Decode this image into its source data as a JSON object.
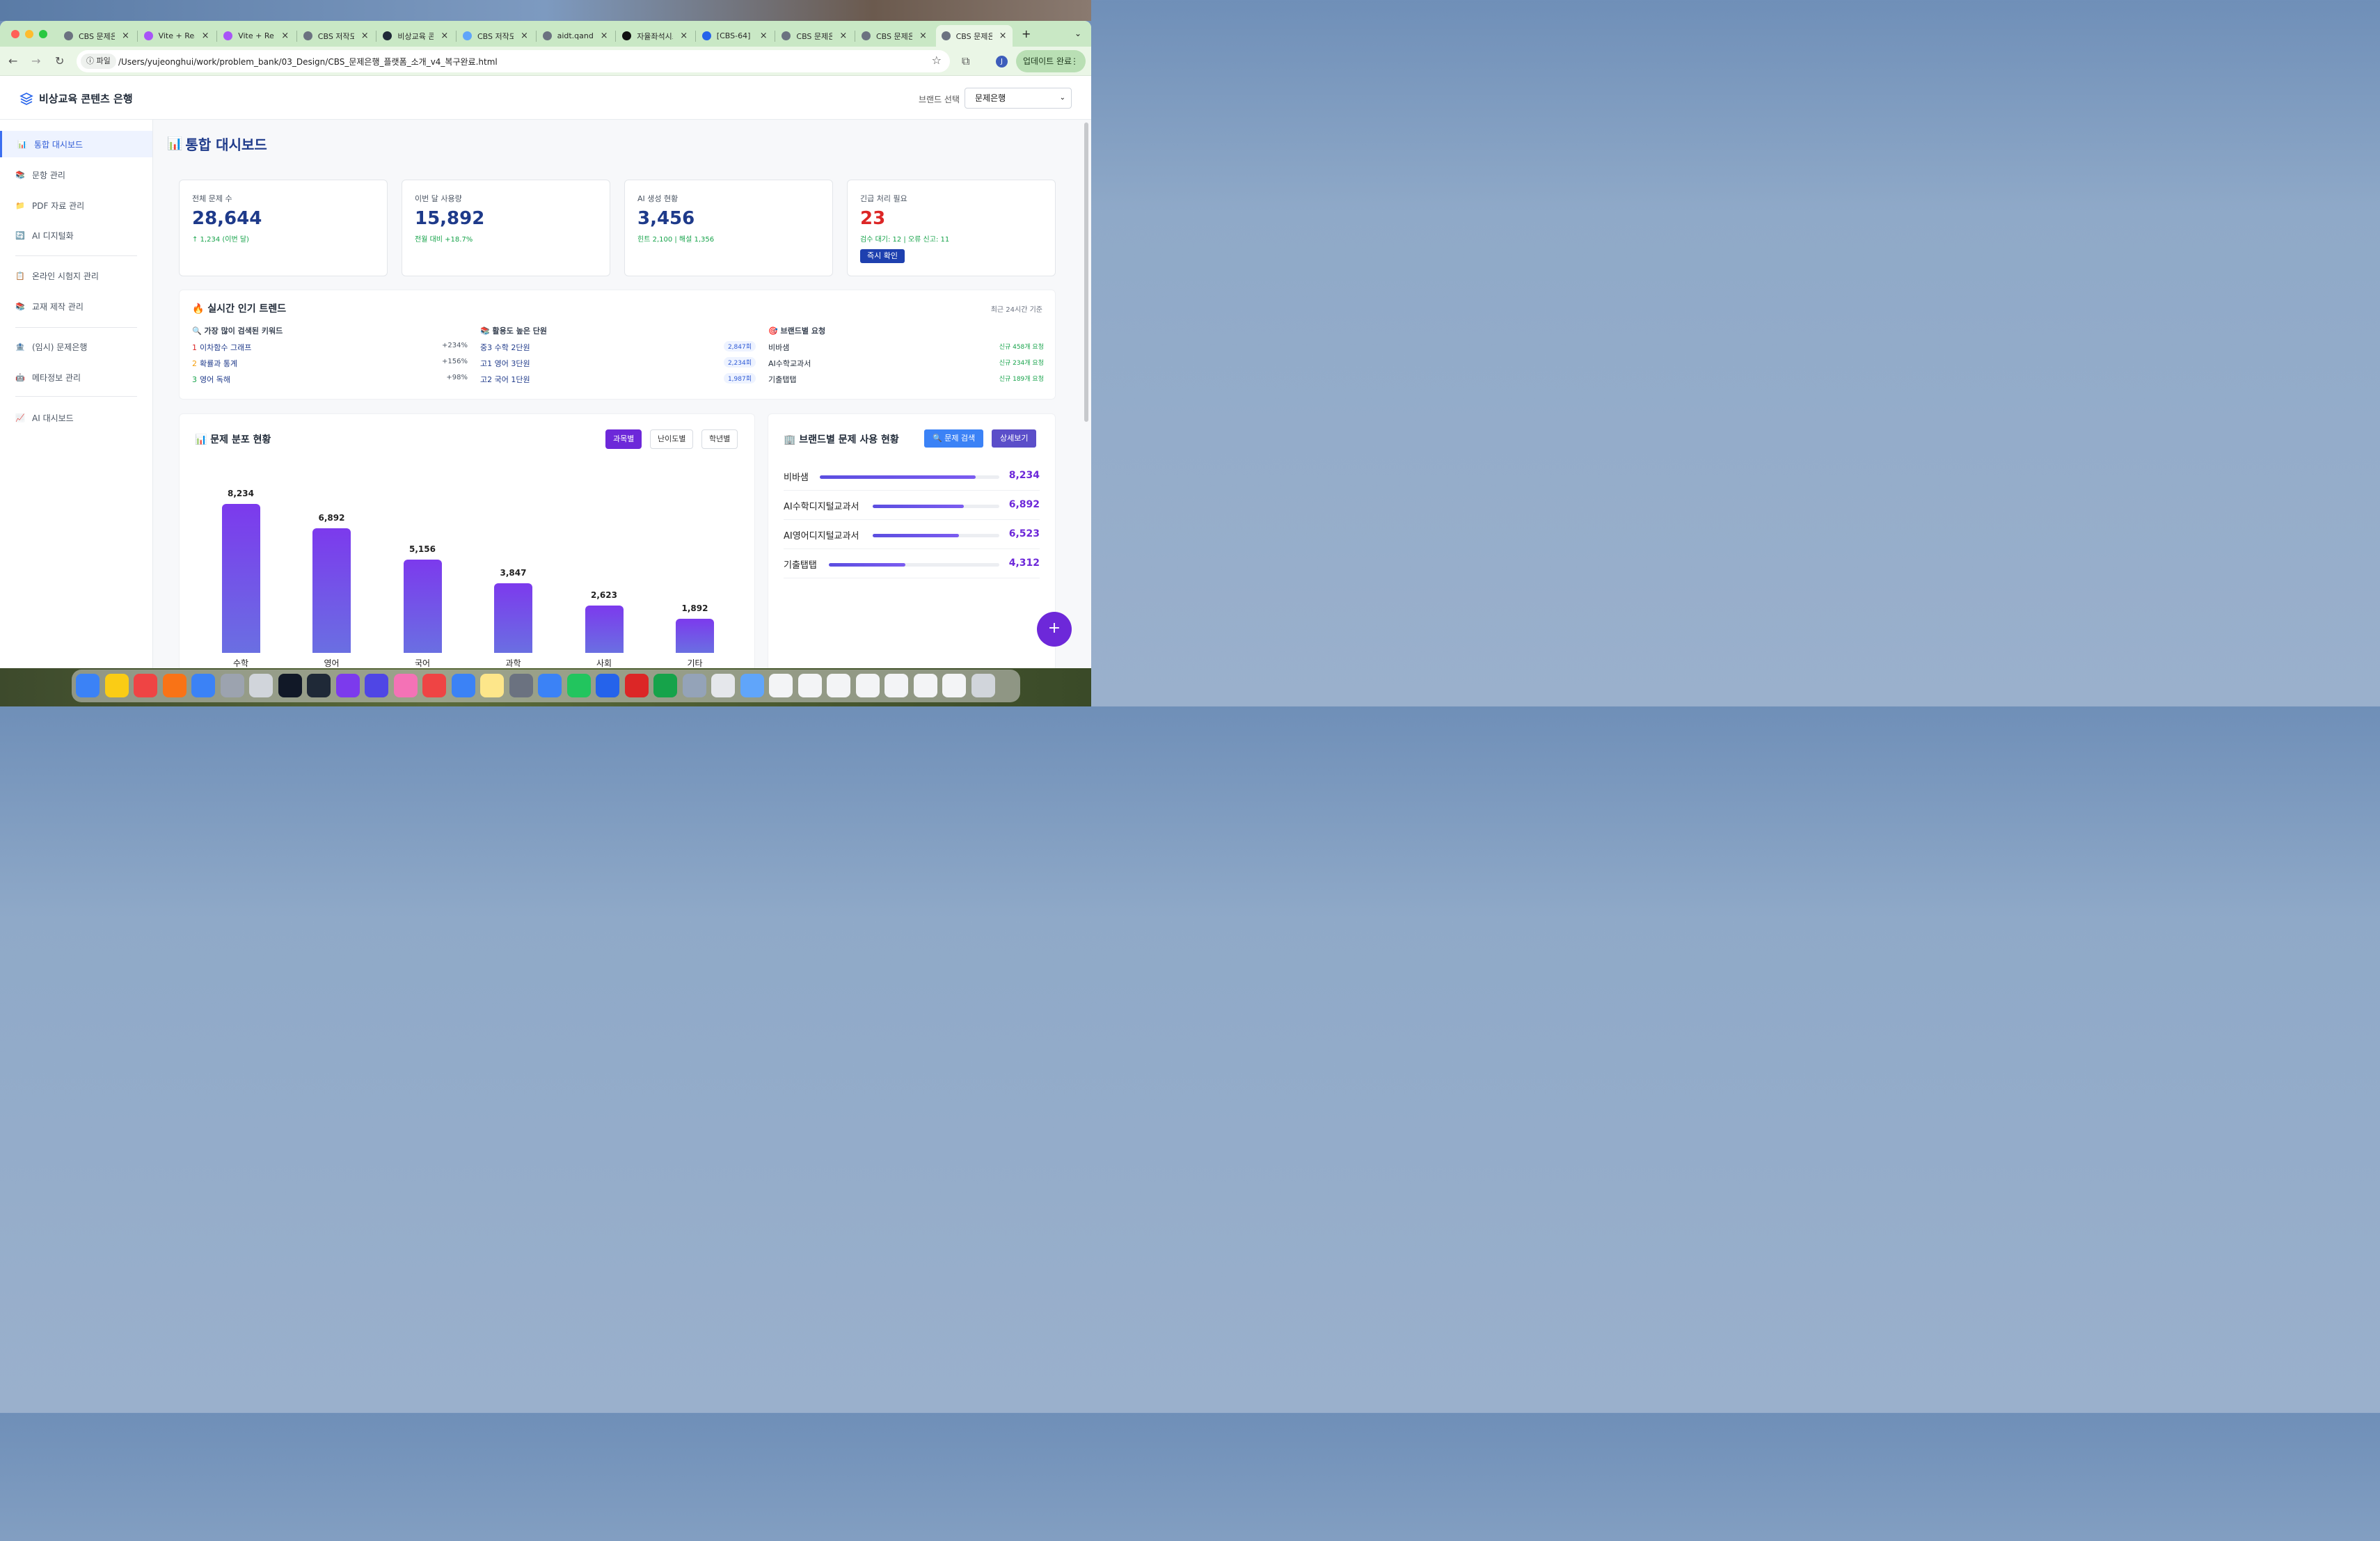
{
  "browser": {
    "tabs": [
      {
        "label": "CBS 문제은행",
        "fav": "#6b7280"
      },
      {
        "label": "Vite + React",
        "fav": "#a855f7"
      },
      {
        "label": "Vite + React",
        "fav": "#a855f7"
      },
      {
        "label": "CBS 저작도구",
        "fav": "#6b7280"
      },
      {
        "label": "비상교육 콘텐츠",
        "fav": "#1f2937"
      },
      {
        "label": "CBS 저작도구",
        "fav": "#60a5fa"
      },
      {
        "label": "aidt.qand",
        "fav": "#6b7280"
      },
      {
        "label": "자율좌석시스템",
        "fav": "#111111"
      },
      {
        "label": "[CBS-64]",
        "fav": "#2563eb"
      },
      {
        "label": "CBS 문제은행",
        "fav": "#6b7280"
      },
      {
        "label": "CBS 문제은행",
        "fav": "#6b7280"
      },
      {
        "label": "CBS 문제은행",
        "fav": "#6b7280"
      }
    ],
    "new_tab": "+",
    "file_chip": "ⓘ 파일",
    "url": "/Users/yujeonghui/work/problem_bank/03_Design/CBS_문제은행_플랫폼_소개_v4_복구완료.html",
    "profile_initial": "J",
    "update_label": "업데이트 완료"
  },
  "app": {
    "logo_text": "비상교육 콘텐츠 은행",
    "brand_label": "브랜드 선택",
    "brand_value": "문제은행",
    "colors": {
      "accent": "#6d28d9",
      "primary": "#1e40af",
      "urgent": "#dc2626",
      "success": "#16a34a"
    }
  },
  "sidebar": {
    "items": [
      {
        "label": "통합 대시보드",
        "icon": "📊"
      },
      {
        "label": "문항 관리",
        "icon": "📚"
      },
      {
        "label": "PDF 자료 관리",
        "icon": "📁"
      },
      {
        "label": "AI 디지털화",
        "icon": "🔄"
      },
      {
        "label": "온라인 시험지 관리",
        "icon": "📋"
      },
      {
        "label": "교재 제작 관리",
        "icon": "📚"
      },
      {
        "label": "(임시) 문제은행",
        "icon": "🏦"
      },
      {
        "label": "메타정보 관리",
        "icon": "🤖"
      },
      {
        "label": "AI 대시보드",
        "icon": "📈"
      }
    ]
  },
  "page": {
    "title": "통합 대시보드",
    "title_icon": "📊"
  },
  "stats": [
    {
      "label": "전체 문제 수",
      "value": "28,644",
      "sub": "↑ 1,234 (이번 달)"
    },
    {
      "label": "이번 달 사용량",
      "value": "15,892",
      "sub": "전월 대비 +18.7%"
    },
    {
      "label": "AI 생성 현황",
      "value": "3,456",
      "sub": "힌트 2,100 | 해설 1,356"
    },
    {
      "label": "긴급 처리 필요",
      "value": "23",
      "sub": "검수 대기: 12 | 오류 신고: 11",
      "button": "즉시 확인"
    }
  ],
  "trends": {
    "title": "🔥 실시간 인기 트렌드",
    "range": "최근 24시간 기준",
    "keywords": {
      "heading": "🔍 가장 많이 검색된 키워드",
      "rows": [
        {
          "rank": "1",
          "label": "이차함수 그래프",
          "value": "+234%"
        },
        {
          "rank": "2",
          "label": "확률과 통계",
          "value": "+156%"
        },
        {
          "rank": "3",
          "label": "영어 독해",
          "value": "+98%"
        }
      ]
    },
    "units": {
      "heading": "📚 활용도 높은 단원",
      "rows": [
        {
          "label": "중3 수학 2단원",
          "value": "2,847회"
        },
        {
          "label": "고1 영어 3단원",
          "value": "2,234회"
        },
        {
          "label": "고2 국어 1단원",
          "value": "1,987회"
        }
      ]
    },
    "brands": {
      "heading": "🎯 브랜드별 요청",
      "rows": [
        {
          "label": "비바샘",
          "value": "신규 458개 요청"
        },
        {
          "label": "AI수학교과서",
          "value": "신규 234개 요청"
        },
        {
          "label": "기출탭탭",
          "value": "신규 189개 요청"
        }
      ]
    }
  },
  "distribution": {
    "title": "📊 문제 분포 현황",
    "filters": [
      "과목별",
      "난이도별",
      "학년별"
    ],
    "active_filter": 0
  },
  "chart_data": {
    "type": "bar",
    "categories": [
      "수학",
      "영어",
      "국어",
      "과학",
      "사회",
      "기타"
    ],
    "values": [
      8234,
      6892,
      5156,
      3847,
      2623,
      1892
    ],
    "value_labels": [
      "8,234",
      "6,892",
      "5,156",
      "3,847",
      "2,623",
      "1,892"
    ]
  },
  "usage": {
    "title": "🏢 브랜드별 문제 사용 현황",
    "search_btn": "🔍 문제 검색",
    "detail_btn": "상세보기",
    "rows": [
      {
        "name": "비바샘",
        "value": "8,234",
        "ratio": 0.87
      },
      {
        "name": "AI수학디지털교과서",
        "value": "6,892",
        "ratio": 0.72
      },
      {
        "name": "AI영어디지털교과서",
        "value": "6,523",
        "ratio": 0.68
      },
      {
        "name": "기출탭탭",
        "value": "4,312",
        "ratio": 0.45
      }
    ]
  },
  "fab_label": "+",
  "dock": {
    "icons": [
      "finder-icon",
      "kakaotalk-icon",
      "sketch-icon",
      "claude-icon",
      "onedrive-icon",
      "launchpad-icon",
      "help-icon",
      "cursor-icon",
      "figma-icon",
      "obsidian-icon",
      "teams-icon",
      "photos-icon",
      "pdf-icon",
      "appstore-icon",
      "notes-icon",
      "settings-icon",
      "safari-icon",
      "chrome-icon",
      "outlook-icon",
      "powerpoint-icon",
      "excel-icon",
      "preview-icon",
      "file-icon",
      "folder-icon",
      "window-thumb-icon",
      "window-thumb-icon",
      "window-thumb-icon",
      "window-thumb-icon",
      "window-thumb-icon",
      "window-thumb-icon",
      "window-thumb-icon",
      "trash-icon"
    ]
  }
}
